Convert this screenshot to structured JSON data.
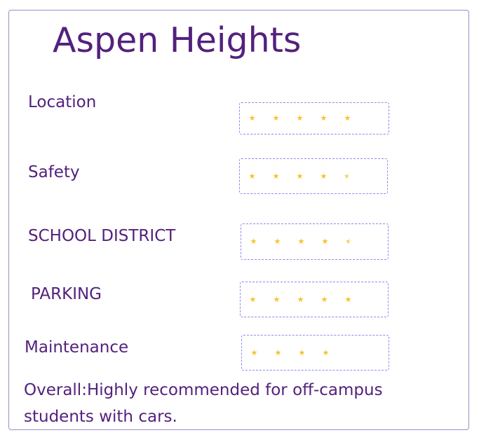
{
  "title": "Aspen Heights",
  "colors": {
    "accent": "#53217d",
    "box_border": "#8f88ef",
    "star_fill": "#f5c32c",
    "star_empty": "#fff4d0"
  },
  "ratings": [
    {
      "label": "Location",
      "stars": 5
    },
    {
      "label": "Safety",
      "stars": 4.5
    },
    {
      "label": "SCHOOL DISTRICT",
      "stars": 4.5
    },
    {
      "label": "PARKING",
      "stars": 5
    },
    {
      "label": "Maintenance",
      "stars": 4
    }
  ],
  "overall": "Overall:Highly recommended for off-campus students with cars."
}
